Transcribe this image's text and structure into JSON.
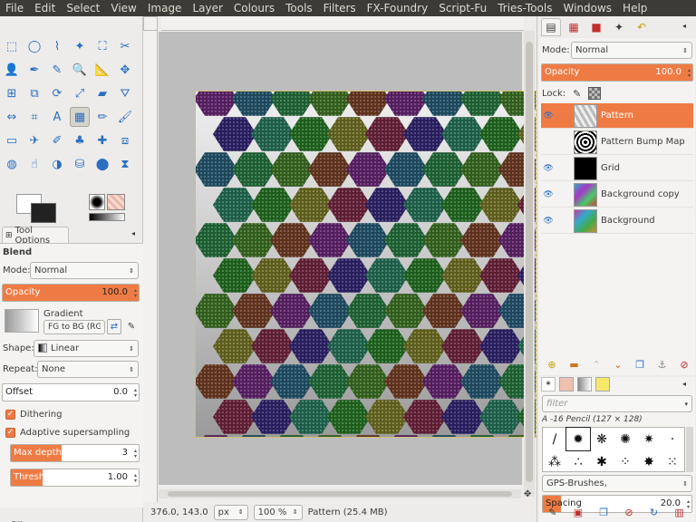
{
  "menu": [
    "File",
    "Edit",
    "Select",
    "View",
    "Image",
    "Layer",
    "Colours",
    "Tools",
    "Filters",
    "FX-Foundry",
    "Script-Fu",
    "Tries-Tools",
    "Windows",
    "Help"
  ],
  "tool_options": {
    "tab_label": "Tool Options",
    "tool_name": "Blend",
    "mode_label": "Mode:",
    "mode_value": "Normal",
    "opacity_label": "Opacity",
    "opacity_value": "100.0",
    "opacity_fraction": 1.0,
    "gradient_label": "Gradient",
    "gradient_value": "FG to BG (RGB",
    "shape_label": "Shape:",
    "shape_value": "Linear",
    "repeat_label": "Repeat:",
    "repeat_value": "None",
    "offset_label": "Offset",
    "offset_value": "0.0",
    "dithering_label": "Dithering",
    "adaptive_label": "Adaptive supersampling",
    "max_depth_label": "Max depth",
    "max_depth_value": "3",
    "max_depth_fraction": 0.4,
    "threshold_label": "Threshold",
    "threshold_value": "1.00",
    "threshold_fraction": 0.25
  },
  "status": {
    "coords": "376.0, 143.0",
    "unit": "px",
    "zoom": "100 %",
    "info": "Pattern (25.4 MB)"
  },
  "layers_panel": {
    "mode_label": "Mode:",
    "mode_value": "Normal",
    "opacity_label": "Opacity",
    "opacity_value": "100.0",
    "lock_label": "Lock:",
    "layers": [
      {
        "name": "Pattern",
        "visible": true,
        "selected": true
      },
      {
        "name": "Pattern Bump Map",
        "visible": false,
        "selected": false
      },
      {
        "name": "Grid",
        "visible": true,
        "selected": false
      },
      {
        "name": "Background copy",
        "visible": true,
        "selected": false
      },
      {
        "name": "Background",
        "visible": true,
        "selected": false
      }
    ]
  },
  "brushes_panel": {
    "filter_placeholder": "filter",
    "brush_name": "A -16 Pencil (127 × 128)",
    "brush_set": "GPS-Brushes,",
    "spacing_label": "Spacing",
    "spacing_value": "20.0"
  },
  "colors": {
    "accent": "#ef7b44",
    "menubar": "#3c3b37"
  }
}
